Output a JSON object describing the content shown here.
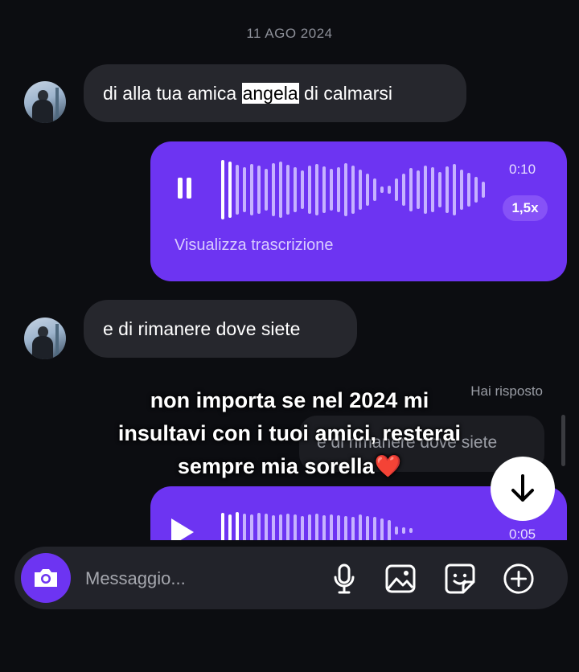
{
  "date_label": "11 AGO 2024",
  "messages": {
    "first": {
      "before": "di alla tua amica ",
      "highlight": "angela",
      "after": " di calmarsi"
    },
    "second": {
      "text": "e di rimanere dove siete"
    }
  },
  "voice1": {
    "time": "0:10",
    "speed": "1,5x",
    "transcript_label": "Visualizza trascrizione",
    "state": "playing"
  },
  "reply": {
    "label": "Hai risposto",
    "quoted": "e di rimanere dove siete"
  },
  "overlay": {
    "line1": "non importa se nel 2024 mi",
    "line2": "insultavi con i tuoi amici, resterai",
    "line3": "sempre mia sorella",
    "heart": "❤️"
  },
  "voice2": {
    "time": "0:05",
    "state": "paused"
  },
  "composer": {
    "placeholder": "Messaggio..."
  },
  "icons": {
    "camera": "camera-icon",
    "mic": "microphone-icon",
    "gallery": "image-icon",
    "sticker": "sticker-icon",
    "plus": "plus-circle-icon",
    "scroll": "arrow-down-icon"
  },
  "colors": {
    "background": "#0c0d11",
    "accent": "#6d34f2",
    "incoming_bubble": "#26272d",
    "waveform": "#c6b2ff"
  }
}
